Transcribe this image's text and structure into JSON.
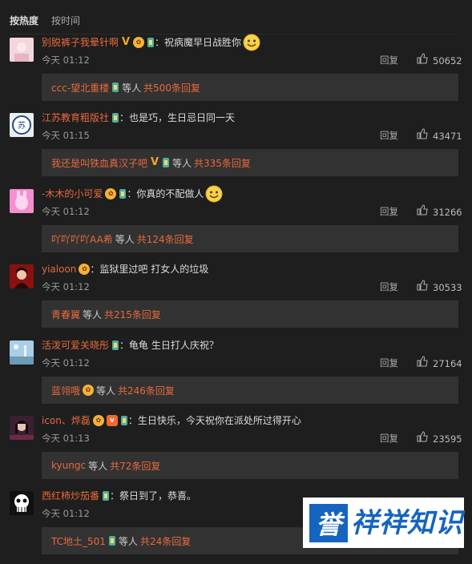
{
  "tabs": [
    {
      "label": "按热度",
      "active": true
    },
    {
      "label": "按时间",
      "active": false
    }
  ],
  "accent_color": "#e8693e",
  "comments": [
    {
      "username": "别脱裤子我晕针啊",
      "text": "：祝病魔早日战胜你",
      "time": "今天 01:12",
      "reply_label": "回复",
      "likes": "50652",
      "sub_user": "ccc-望北重楼",
      "sub_mid": "等人",
      "sub_count": "共500条回复"
    },
    {
      "username": "江苏教育粗版社",
      "text": "：也是巧，生日忌日同一天",
      "time": "今天 01:15",
      "reply_label": "回复",
      "likes": "43471",
      "sub_user": "我还是叫铁血真汉子吧",
      "sub_mid": "等人",
      "sub_count": "共335条回复"
    },
    {
      "username": "-木木的小可爱",
      "text": "：你真的不配做人",
      "time": "今天 01:12",
      "reply_label": "回复",
      "likes": "31266",
      "sub_user": "吖吖吖吖AA希",
      "sub_mid": "等人",
      "sub_count": "共124条回复"
    },
    {
      "username": "yialoon",
      "text": "：监狱里过吧 打女人的垃圾",
      "time": "今天 01:12",
      "reply_label": "回复",
      "likes": "30533",
      "sub_user": "青春翼",
      "sub_mid": "等人",
      "sub_count": "共215条回复"
    },
    {
      "username": "活泼可爱关晓彤",
      "text": "：龟龟 生日打人庆祝？",
      "time": "今天 01:12",
      "reply_label": "回复",
      "likes": "27164",
      "sub_user": "蓝翎哦",
      "sub_mid": "等人",
      "sub_count": "共246条回复"
    },
    {
      "username": "icon、烨磊",
      "text": "：生日快乐，今天祝你在派处所过得开心",
      "time": "今天 01:13",
      "reply_label": "回复",
      "likes": "23595",
      "sub_user": "kyungc",
      "sub_mid": "等人",
      "sub_count": "共72条回复"
    },
    {
      "username": "西红柿炒茄番",
      "text": "：祭日到了，恭喜。",
      "time": "今天 01:12",
      "reply_label": "回复",
      "likes": "",
      "sub_user": "TC地土_501",
      "sub_mid": "等人",
      "sub_count": "共24条回复"
    }
  ],
  "watermark": {
    "logo_char": "誉",
    "text": "祥祥知识"
  }
}
